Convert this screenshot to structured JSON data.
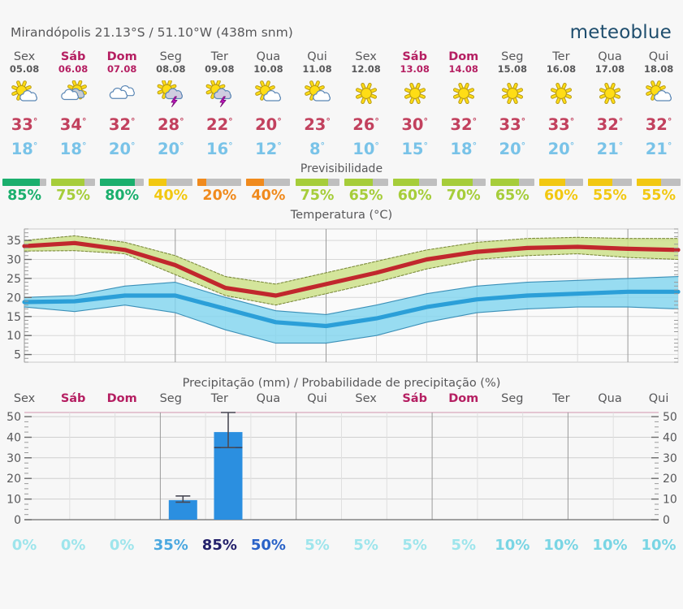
{
  "header": {
    "location_name": "Mirandópolis",
    "coords": "21.13°S / 51.10°W (438m snm)",
    "location_full": "Mirandópolis  21.13°S / 51.10°W (438m snm)",
    "logo": "meteoblue"
  },
  "labels": {
    "predictability_title": "Previsibilidade",
    "temperature_title": "Temperatura (°C)",
    "precipitation_title": "Precipitação (mm) / Probabilidade de precipitação (%)"
  },
  "days": [
    {
      "name": "Sex",
      "date": "05.08",
      "weekend": false,
      "icon": "sun-cloud-icon",
      "tmax": "33",
      "tmin": "18",
      "pred_pct": "85%",
      "pred_value": 85,
      "pred_color": "#1aaf6d",
      "precip_pct": "0%",
      "precip_prob": 0,
      "precip_mm": 0,
      "precip_mm_low": 0,
      "precip_mm_high": 0
    },
    {
      "name": "Sáb",
      "date": "06.08",
      "weekend": true,
      "icon": "cloud-sun-icon",
      "tmax": "34",
      "tmin": "18",
      "pred_pct": "75%",
      "pred_value": 75,
      "pred_color": "#a6cd3a",
      "precip_pct": "0%",
      "precip_prob": 0,
      "precip_mm": 0,
      "precip_mm_low": 0,
      "precip_mm_high": 0
    },
    {
      "name": "Dom",
      "date": "07.08",
      "weekend": true,
      "icon": "cloudy-icon",
      "tmax": "32",
      "tmin": "20",
      "pred_pct": "80%",
      "pred_value": 80,
      "pred_color": "#1aaf6d",
      "precip_pct": "0%",
      "precip_prob": 0,
      "precip_mm": 0,
      "precip_mm_low": 0,
      "precip_mm_high": 0
    },
    {
      "name": "Seg",
      "date": "08.08",
      "weekend": false,
      "icon": "thunderstorm-sun-icon",
      "tmax": "28",
      "tmin": "20",
      "pred_pct": "40%",
      "pred_value": 40,
      "pred_color": "#f2c811",
      "precip_pct": "35%",
      "precip_prob": 35,
      "precip_mm": 9.5,
      "precip_mm_low": 8.5,
      "precip_mm_high": 11.5
    },
    {
      "name": "Ter",
      "date": "09.08",
      "weekend": false,
      "icon": "thunderstorm-sun-icon",
      "tmax": "22",
      "tmin": "16",
      "pred_pct": "20%",
      "pred_value": 20,
      "pred_color": "#f08a1d",
      "precip_pct": "85%",
      "precip_prob": 85,
      "precip_mm": 42.5,
      "precip_mm_low": 35,
      "precip_mm_high": 52,
      "precip_sub_mm": 35
    },
    {
      "name": "Qua",
      "date": "10.08",
      "weekend": false,
      "icon": "sun-cloud-icon",
      "tmax": "20",
      "tmin": "12",
      "pred_pct": "40%",
      "pred_value": 40,
      "pred_color": "#f08a1d",
      "precip_pct": "50%",
      "precip_prob": 50,
      "precip_mm": 0,
      "precip_mm_low": 0,
      "precip_mm_high": 0
    },
    {
      "name": "Qui",
      "date": "11.08",
      "weekend": false,
      "icon": "sun-cloud-icon",
      "tmax": "23",
      "tmin": "8",
      "pred_pct": "75%",
      "pred_value": 75,
      "pred_color": "#a6cd3a",
      "precip_pct": "5%",
      "precip_prob": 5,
      "precip_mm": 0,
      "precip_mm_low": 0,
      "precip_mm_high": 0
    },
    {
      "name": "Sex",
      "date": "12.08",
      "weekend": false,
      "icon": "sun-icon",
      "tmax": "26",
      "tmin": "10",
      "pred_pct": "65%",
      "pred_value": 65,
      "pred_color": "#a6cd3a",
      "precip_pct": "5%",
      "precip_prob": 5,
      "precip_mm": 0,
      "precip_mm_low": 0,
      "precip_mm_high": 0
    },
    {
      "name": "Sáb",
      "date": "13.08",
      "weekend": true,
      "icon": "sun-icon",
      "tmax": "30",
      "tmin": "15",
      "pred_pct": "60%",
      "pred_value": 60,
      "pred_color": "#a6cd3a",
      "precip_pct": "5%",
      "precip_prob": 5,
      "precip_mm": 0,
      "precip_mm_low": 0,
      "precip_mm_high": 0
    },
    {
      "name": "Dom",
      "date": "14.08",
      "weekend": true,
      "icon": "sun-icon",
      "tmax": "32",
      "tmin": "18",
      "pred_pct": "70%",
      "pred_value": 70,
      "pred_color": "#a6cd3a",
      "precip_pct": "5%",
      "precip_prob": 5,
      "precip_mm": 0,
      "precip_mm_low": 0,
      "precip_mm_high": 0
    },
    {
      "name": "Seg",
      "date": "15.08",
      "weekend": false,
      "icon": "sun-icon",
      "tmax": "33",
      "tmin": "20",
      "pred_pct": "65%",
      "pred_value": 65,
      "pred_color": "#a6cd3a",
      "precip_pct": "10%",
      "precip_prob": 10,
      "precip_mm": 0,
      "precip_mm_low": 0,
      "precip_mm_high": 0
    },
    {
      "name": "Ter",
      "date": "16.08",
      "weekend": false,
      "icon": "sun-icon",
      "tmax": "33",
      "tmin": "20",
      "pred_pct": "60%",
      "pred_value": 60,
      "pred_color": "#f2c811",
      "precip_pct": "10%",
      "precip_prob": 10,
      "precip_mm": 0,
      "precip_mm_low": 0,
      "precip_mm_high": 0
    },
    {
      "name": "Qua",
      "date": "17.08",
      "weekend": false,
      "icon": "sun-icon",
      "tmax": "32",
      "tmin": "21",
      "pred_pct": "55%",
      "pred_value": 55,
      "pred_color": "#f2c811",
      "precip_pct": "10%",
      "precip_prob": 10,
      "precip_mm": 0,
      "precip_mm_low": 0,
      "precip_mm_high": 0
    },
    {
      "name": "Qui",
      "date": "18.08",
      "weekend": false,
      "icon": "sun-cloud-icon",
      "tmax": "32",
      "tmin": "21",
      "pred_pct": "55%",
      "pred_value": 55,
      "pred_color": "#f2c811",
      "precip_pct": "10%",
      "precip_prob": 10,
      "precip_mm": 0,
      "precip_mm_low": 0,
      "precip_mm_high": 0
    }
  ],
  "chart_data": [
    {
      "type": "line",
      "name": "temperature",
      "title": "Temperatura (°C)",
      "xlabel": "",
      "ylabel": "°C",
      "ylim": [
        3,
        38
      ],
      "yticks": [
        5,
        10,
        15,
        20,
        25,
        30,
        35
      ],
      "grid": true,
      "x": [
        "05.08",
        "06.08",
        "07.08",
        "08.08",
        "09.08",
        "10.08",
        "11.08",
        "12.08",
        "13.08",
        "14.08",
        "15.08",
        "16.08",
        "17.08",
        "18.08"
      ],
      "series": [
        {
          "name": "Temperatura máxima",
          "color": "#c1272d",
          "values": [
            33.5,
            34.3,
            32.5,
            28.5,
            22.5,
            20.5,
            23.5,
            26.5,
            30,
            32,
            33,
            33.3,
            32.8,
            32.5
          ]
        },
        {
          "name": "Máxima banda superior",
          "color": "#d9e79a",
          "values": [
            35,
            36.2,
            34.5,
            31,
            25.5,
            23.5,
            26.5,
            29.5,
            32.5,
            34.5,
            35.5,
            35.8,
            35.5,
            35.5
          ]
        },
        {
          "name": "Máxima banda inferior",
          "color": "#d9e79a",
          "values": [
            32.2,
            32.3,
            31.5,
            26,
            20.5,
            18,
            21,
            24,
            27.5,
            30,
            31,
            31.5,
            30.5,
            30
          ]
        },
        {
          "name": "Temperatura mínima",
          "color": "#2b9fd8",
          "values": [
            18.8,
            19,
            20.5,
            20.5,
            17,
            13.5,
            12.5,
            14.5,
            17.5,
            19.5,
            20.5,
            21,
            21.5,
            21.5
          ]
        },
        {
          "name": "Mínima banda superior",
          "color": "#7fd4ef",
          "values": [
            20,
            20.5,
            23,
            24,
            20,
            16.5,
            15.5,
            18,
            21,
            23,
            24,
            24.5,
            25,
            25.5
          ]
        },
        {
          "name": "Mínima banda inferior",
          "color": "#7fd4ef",
          "values": [
            17.5,
            16.3,
            18,
            16,
            11.5,
            8,
            8,
            10,
            13.5,
            16,
            17,
            17.5,
            17.5,
            17
          ]
        }
      ]
    },
    {
      "type": "bar",
      "name": "precipitation",
      "title": "Precipitação (mm) / Probabilidade de precipitação (%)",
      "ylabel": "mm",
      "ylim": [
        0,
        52
      ],
      "yticks": [
        0,
        10,
        20,
        30,
        40,
        50
      ],
      "grid": true,
      "categories": [
        "05.08",
        "06.08",
        "07.08",
        "08.08",
        "09.08",
        "10.08",
        "11.08",
        "12.08",
        "13.08",
        "14.08",
        "15.08",
        "16.08",
        "17.08",
        "18.08"
      ],
      "values": [
        0,
        0,
        0,
        9.5,
        42.5,
        0,
        0,
        0,
        0,
        0,
        0,
        0,
        0,
        0
      ],
      "error_low": [
        0,
        0,
        0,
        8.5,
        35,
        0,
        0,
        0,
        0,
        0,
        0,
        0,
        0,
        0
      ],
      "error_high": [
        0,
        0,
        0,
        11.5,
        52,
        0,
        0,
        0,
        0,
        0,
        0,
        0,
        0,
        0
      ],
      "probability": [
        0,
        0,
        0,
        35,
        85,
        50,
        5,
        5,
        5,
        5,
        10,
        10,
        10,
        10
      ],
      "probability_labels": [
        "0%",
        "0%",
        "0%",
        "35%",
        "85%",
        "50%",
        "5%",
        "5%",
        "5%",
        "5%",
        "10%",
        "10%",
        "10%",
        "10%"
      ],
      "bar_color": "#2b8fe0"
    }
  ],
  "colors": {
    "weekend": "#b51f62",
    "tmax": "#c2415e",
    "tmin": "#79c3e8",
    "brand": "#1f4e6e",
    "bg": "#f7f7f7"
  }
}
